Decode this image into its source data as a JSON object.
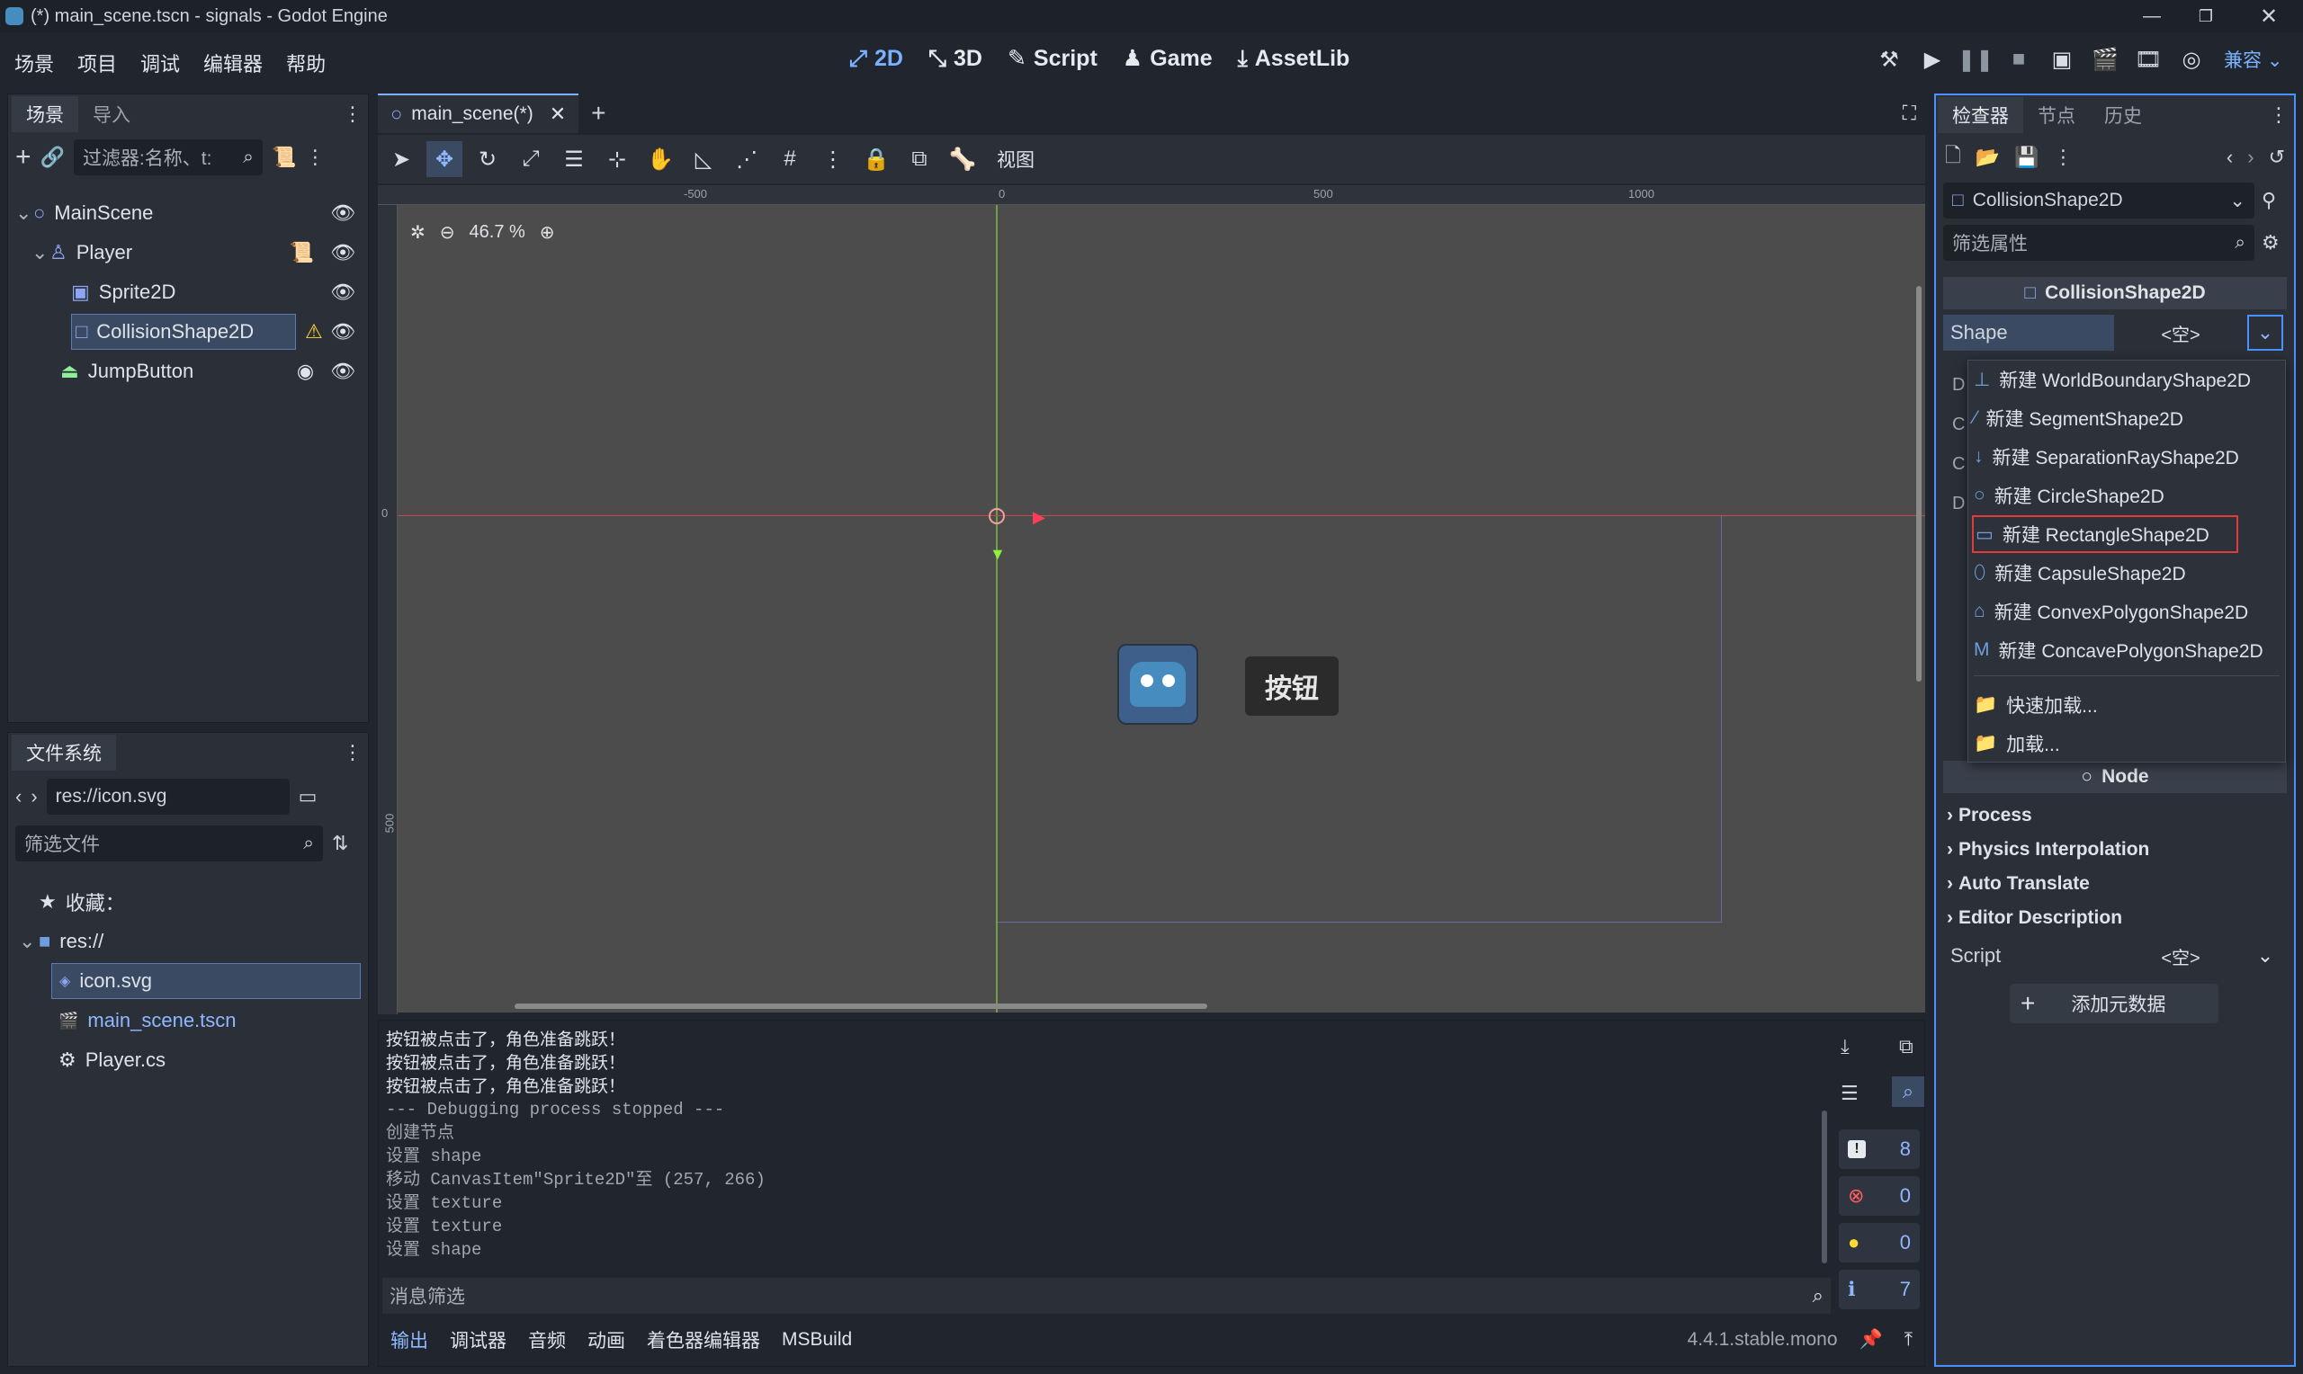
{
  "window": {
    "title": "(*) main_scene.tscn - signals - Godot Engine"
  },
  "menu": [
    "场景",
    "项目",
    "调试",
    "编辑器",
    "帮助"
  ],
  "workspaces": [
    {
      "icon": "2d-icon",
      "label": "2D"
    },
    {
      "icon": "3d-icon",
      "label": "3D"
    },
    {
      "icon": "script-icon",
      "label": "Script"
    },
    {
      "icon": "game-icon",
      "label": "Game"
    },
    {
      "icon": "assetlib-icon",
      "label": "AssetLib"
    }
  ],
  "renderer": "兼容",
  "scene_dock": {
    "tabs": [
      "场景",
      "导入"
    ],
    "filter_placeholder": "过滤器:名称、t:",
    "tree": [
      {
        "label": "MainScene",
        "icon": "node2d-icon",
        "depth": 0
      },
      {
        "label": "Player",
        "icon": "characterbody-icon",
        "depth": 1
      },
      {
        "label": "Sprite2D",
        "icon": "sprite-icon",
        "depth": 2
      },
      {
        "label": "CollisionShape2D",
        "icon": "collision-shape-icon",
        "depth": 2,
        "selected": true,
        "warning": true
      },
      {
        "label": "JumpButton",
        "icon": "button-icon",
        "depth": 1
      }
    ]
  },
  "filesystem": {
    "tab": "文件系统",
    "path": "res://icon.svg",
    "filter_placeholder": "筛选文件",
    "favorites": "收藏：",
    "root": "res://",
    "files": [
      {
        "label": "icon.svg",
        "icon": "svg-icon",
        "selected": true
      },
      {
        "label": "main_scene.tscn",
        "icon": "scene-icon",
        "link": true
      },
      {
        "label": "Player.cs",
        "icon": "csharp-icon"
      }
    ]
  },
  "editor": {
    "scene_tab": "main_scene(*)",
    "view_menu": "视图",
    "zoom": "46.7 %",
    "ruler": {
      "h": [
        "-500",
        "0",
        "500",
        "1000"
      ],
      "v": [
        "0",
        "500"
      ]
    },
    "button_label": "按钮"
  },
  "output": {
    "lines": [
      "按钮被点击了，角色准备跳跃！",
      "按钮被点击了，角色准备跳跃！",
      "按钮被点击了，角色准备跳跃！",
      "--- Debugging process stopped ---",
      "创建节点",
      "设置 shape",
      "移动 CanvasItem\"Sprite2D\"至 (257, 266)",
      "设置 texture",
      "设置 texture",
      "设置 shape"
    ],
    "filter_placeholder": "消息筛选",
    "counts": {
      "messages": "8",
      "errors": "0",
      "warnings": "0",
      "editor": "7"
    }
  },
  "bottom_tabs": [
    "输出",
    "调试器",
    "音频",
    "动画",
    "着色器编辑器",
    "MSBuild"
  ],
  "version": "4.4.1.stable.mono",
  "inspector": {
    "tabs": [
      "检查器",
      "节点",
      "历史"
    ],
    "object": "CollisionShape2D",
    "filter_placeholder": "筛选属性",
    "section_title": "CollisionShape2D",
    "shape_label": "Shape",
    "empty_value": "<空>",
    "dropdown": [
      {
        "label": "新建 WorldBoundaryShape2D",
        "icon": "world-boundary-icon"
      },
      {
        "label": "新建 SegmentShape2D",
        "icon": "segment-icon"
      },
      {
        "label": "新建 SeparationRayShape2D",
        "icon": "separation-ray-icon"
      },
      {
        "label": "新建 CircleShape2D",
        "icon": "circle-shape-icon"
      },
      {
        "label": "新建 RectangleShape2D",
        "icon": "rectangle-shape-icon",
        "highlighted": true
      },
      {
        "label": "新建 CapsuleShape2D",
        "icon": "capsule-icon"
      },
      {
        "label": "新建 ConvexPolygonShape2D",
        "icon": "convex-polygon-icon"
      },
      {
        "label": "新建 ConcavePolygonShape2D",
        "icon": "concave-polygon-icon"
      },
      {
        "label": "快速加载...",
        "icon": "folder-icon"
      },
      {
        "label": "加载...",
        "icon": "folder-icon"
      }
    ],
    "node_section": "Node",
    "groups": [
      "Process",
      "Physics Interpolation",
      "Auto Translate",
      "Editor Description"
    ],
    "script_label": "Script",
    "add_metadata": "添加元数据"
  }
}
